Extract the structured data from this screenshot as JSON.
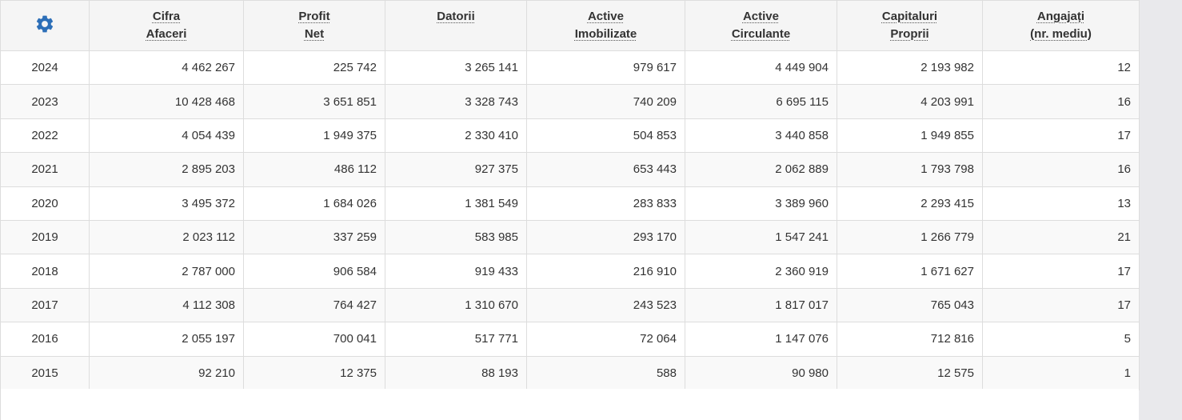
{
  "table": {
    "columns": [
      {
        "key": "settings",
        "lines": []
      },
      {
        "key": "cifra_afaceri",
        "lines": [
          "Cifra",
          "Afaceri"
        ]
      },
      {
        "key": "profit_net",
        "lines": [
          "Profit",
          "Net"
        ]
      },
      {
        "key": "datorii",
        "lines": [
          "Datorii"
        ]
      },
      {
        "key": "active_imobilizate",
        "lines": [
          "Active",
          "Imobilizate"
        ]
      },
      {
        "key": "active_circulante",
        "lines": [
          "Active",
          "Circulante"
        ]
      },
      {
        "key": "capitaluri_proprii",
        "lines": [
          "Capitaluri",
          "Proprii"
        ]
      },
      {
        "key": "angajati",
        "lines": [
          "Angajați",
          "(nr. mediu)"
        ]
      }
    ],
    "rows": [
      [
        "2024",
        "4 462 267",
        "225 742",
        "3 265 141",
        "979 617",
        "4 449 904",
        "2 193 982",
        "12"
      ],
      [
        "2023",
        "10 428 468",
        "3 651 851",
        "3 328 743",
        "740 209",
        "6 695 115",
        "4 203 991",
        "16"
      ],
      [
        "2022",
        "4 054 439",
        "1 949 375",
        "2 330 410",
        "504 853",
        "3 440 858",
        "1 949 855",
        "17"
      ],
      [
        "2021",
        "2 895 203",
        "486 112",
        "927 375",
        "653 443",
        "2 062 889",
        "1 793 798",
        "16"
      ],
      [
        "2020",
        "3 495 372",
        "1 684 026",
        "1 381 549",
        "283 833",
        "3 389 960",
        "2 293 415",
        "13"
      ],
      [
        "2019",
        "2 023 112",
        "337 259",
        "583 985",
        "293 170",
        "1 547 241",
        "1 266 779",
        "21"
      ],
      [
        "2018",
        "2 787 000",
        "906 584",
        "919 433",
        "216 910",
        "2 360 919",
        "1 671 627",
        "17"
      ],
      [
        "2017",
        "4 112 308",
        "764 427",
        "1 310 670",
        "243 523",
        "1 817 017",
        "765 043",
        "17"
      ],
      [
        "2016",
        "2 055 197",
        "700 041",
        "517 771",
        "72 064",
        "1 147 076",
        "712 816",
        "5"
      ],
      [
        "2015",
        "92 210",
        "12 375",
        "88 193",
        "588",
        "90 980",
        "12 575",
        "1"
      ]
    ]
  },
  "icons": {
    "settings": "gear-icon"
  },
  "colors": {
    "gear": "#2d6fb8",
    "header_bg": "#f5f5f5",
    "border": "#dddddd",
    "stripe": "#f9f9f9",
    "text": "#333333"
  }
}
